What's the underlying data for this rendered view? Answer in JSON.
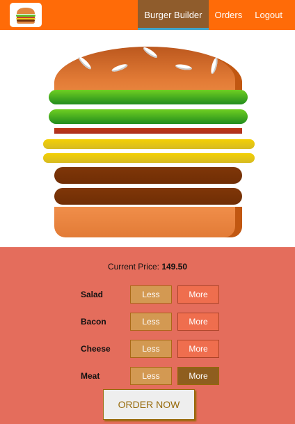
{
  "header": {
    "logo_icon": "burger-logo-icon",
    "nav": [
      {
        "label": "Burger Builder",
        "active": true
      },
      {
        "label": "Orders",
        "active": false
      },
      {
        "label": "Logout",
        "active": false
      }
    ]
  },
  "burger": {
    "ingredients_top_to_bottom": [
      "salad",
      "salad",
      "bacon",
      "cheese",
      "cheese",
      "meat",
      "meat"
    ]
  },
  "build_controls": {
    "price_label": "Current Price:",
    "price_value": "149.50",
    "rows": [
      {
        "label": "Salad",
        "less": "Less",
        "more": "More"
      },
      {
        "label": "Bacon",
        "less": "Less",
        "more": "More"
      },
      {
        "label": "Cheese",
        "less": "Less",
        "more": "More"
      },
      {
        "label": "Meat",
        "less": "Less",
        "more": "More"
      }
    ],
    "order_button": "ORDER NOW"
  },
  "colors": {
    "toolbar": "#ff6b08",
    "active_nav": "#8f5c2c",
    "controls_bg": "#e46d5c",
    "less_button": "#d39952",
    "more_button": "#ef6e4e"
  }
}
